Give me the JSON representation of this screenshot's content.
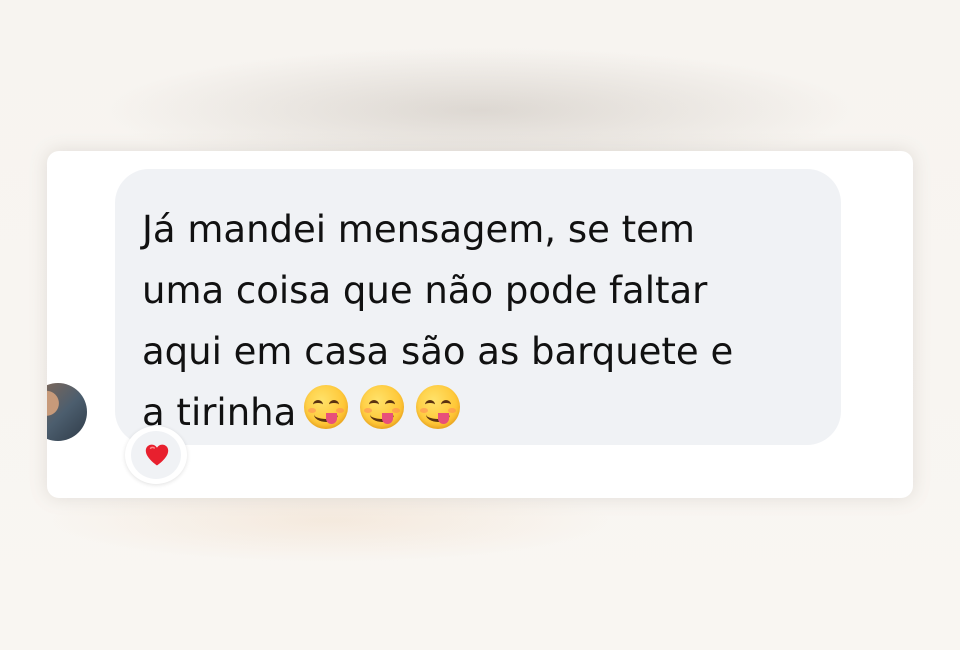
{
  "message": {
    "text": "Já mandei mensagem, se tem\numa coisa que não pode faltar\naqui em casa são as barquete e\na tirinha",
    "emoji_icons": [
      "yum-face-icon",
      "yum-face-icon",
      "yum-face-icon"
    ]
  },
  "reaction": {
    "icon": "red-heart-icon"
  },
  "colors": {
    "bubble": "#f0f2f5",
    "text": "#111111",
    "heart": "#e8202e"
  }
}
